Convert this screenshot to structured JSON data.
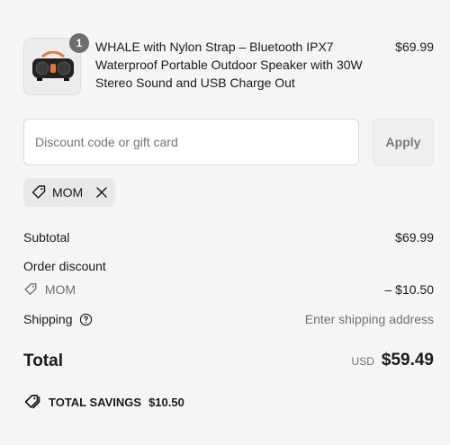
{
  "line_item": {
    "quantity": "1",
    "title": "WHALE with Nylon Strap – Bluetooth IPX7 Waterproof Portable Outdoor Speaker with 30W Stereo Sound and USB Charge Out",
    "price": "$69.99",
    "image_icon": "speaker-product-image"
  },
  "discount": {
    "placeholder": "Discount code or gift card",
    "apply_label": "Apply",
    "applied_code": "MOM"
  },
  "summary": {
    "subtotal_label": "Subtotal",
    "subtotal_value": "$69.99",
    "order_discount_label": "Order discount",
    "discount_code": "MOM",
    "discount_value": "– $10.50",
    "shipping_label": "Shipping",
    "shipping_value": "Enter shipping address",
    "total_label": "Total",
    "currency": "USD",
    "total_value": "$59.49",
    "savings_label": "TOTAL SAVINGS",
    "savings_value": "$10.50"
  },
  "colors": {
    "background": "#f5f5f5",
    "text": "#1a1a1a",
    "muted": "#707070",
    "badge": "#6e6e6e",
    "speaker_accent": "#e8763a"
  }
}
